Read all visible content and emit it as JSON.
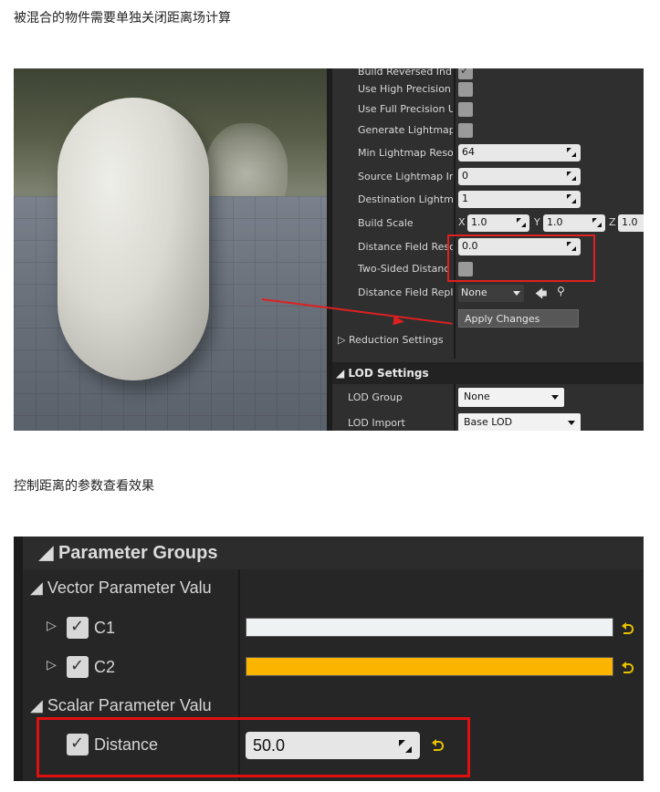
{
  "captions": {
    "first": "被混合的物件需要单独关闭距离场计算",
    "second": "控制距离的参数查看效果"
  },
  "mesh_panel": {
    "rows": [
      {
        "label": "Build Reversed Ind",
        "type": "checkbox",
        "checked": true
      },
      {
        "label": "Use High Precision",
        "type": "checkbox",
        "checked": false
      },
      {
        "label": "Use Full Precision U",
        "type": "checkbox",
        "checked": false
      },
      {
        "label": "Generate Lightmap",
        "type": "checkbox",
        "checked": false
      },
      {
        "label": "Min Lightmap Reso",
        "type": "number",
        "value": "64"
      },
      {
        "label": "Source Lightmap In",
        "type": "number",
        "value": "0"
      },
      {
        "label": "Destination Lightm",
        "type": "number",
        "value": "1"
      },
      {
        "label": "Build Scale",
        "type": "vector",
        "x": "1.0",
        "y": "1.0",
        "z": "1.0"
      },
      {
        "label": "Distance Field Reso",
        "type": "number",
        "value": "0.0"
      },
      {
        "label": "Two-Sided Distanc",
        "type": "checkbox",
        "checked": false
      },
      {
        "label": "Distance Field Repl",
        "type": "asset",
        "value": "None"
      }
    ],
    "axis_labels": {
      "x": "X",
      "y": "Y",
      "z": "Z"
    },
    "apply_label": "Apply Changes",
    "reduction_label": "Reduction Settings",
    "lod_header": "LOD Settings",
    "lod_group_label": "LOD Group",
    "lod_group_value": "None",
    "lod_import_label": "LOD Import",
    "lod_import_value": "Base LOD"
  },
  "material_panel": {
    "header": "Parameter Groups",
    "vector_group": "Vector Parameter Valu",
    "vectors": [
      {
        "name": "C1",
        "color": "#eef2f3",
        "checked": true
      },
      {
        "name": "C2",
        "color": "#fbb400",
        "checked": true
      }
    ],
    "scalar_group": "Scalar Parameter Valu",
    "scalar": {
      "name": "Distance",
      "value": "50.0",
      "checked": true
    }
  },
  "annotation_color": "#e01010"
}
